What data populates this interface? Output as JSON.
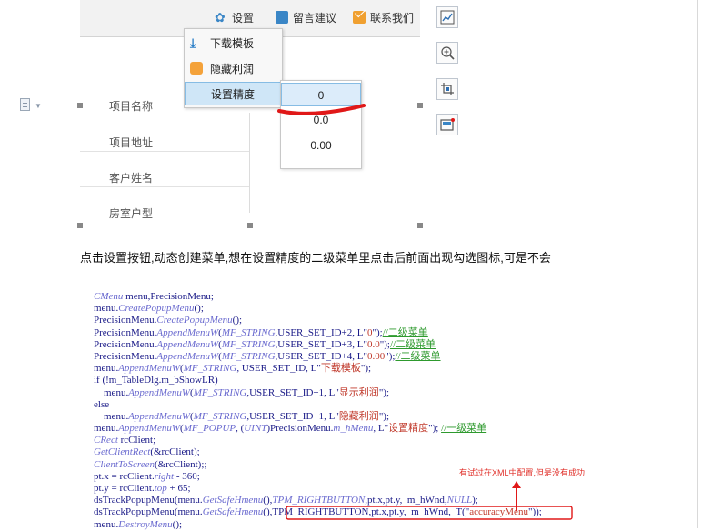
{
  "embedded_app": {
    "toolbar": [
      {
        "label": "设置",
        "icon": "gear-icon"
      },
      {
        "label": "留言建议",
        "icon": "message-icon"
      },
      {
        "label": "联系我们",
        "icon": "mail-icon"
      }
    ],
    "fields": [
      "项目名称",
      "项目地址",
      "客户姓名",
      "房室户型"
    ],
    "menu": [
      {
        "label": "下载模板",
        "icon": "download-icon"
      },
      {
        "label": "隐藏利润",
        "icon": "database-icon"
      },
      {
        "label": "设置精度",
        "icon": ""
      }
    ],
    "submenu": [
      "0",
      "0.0",
      "0.00"
    ]
  },
  "right_toolbar": [
    "chart-icon",
    "zoom-icon",
    "crop-icon",
    "frame-icon"
  ],
  "description": "点击设置按钮,动态创建菜单,想在设置精度的二级菜单里点击后前面出现勾选图标,可是不会",
  "code_lines": [
    [
      {
        "t": "t",
        "v": "CMenu"
      },
      {
        "t": "k",
        "v": " menu,PrecisionMenu;"
      }
    ],
    [
      {
        "t": "k",
        "v": "menu."
      },
      {
        "t": "t",
        "v": "CreatePopupMenu"
      },
      {
        "t": "k",
        "v": "();"
      }
    ],
    [
      {
        "t": "k",
        "v": "PrecisionMenu."
      },
      {
        "t": "t",
        "v": "CreatePopupMenu"
      },
      {
        "t": "k",
        "v": "();"
      }
    ],
    [
      {
        "t": "k",
        "v": "PrecisionMenu."
      },
      {
        "t": "t",
        "v": "AppendMenuW"
      },
      {
        "t": "k",
        "v": "("
      },
      {
        "t": "t",
        "v": "MF_STRING"
      },
      {
        "t": "k",
        "v": ",USER_SET_ID+2, L\""
      },
      {
        "t": "s",
        "v": "0"
      },
      {
        "t": "k",
        "v": "\");"
      },
      {
        "t": "c",
        "v": "//二级菜单"
      }
    ],
    [
      {
        "t": "k",
        "v": "PrecisionMenu."
      },
      {
        "t": "t",
        "v": "AppendMenuW"
      },
      {
        "t": "k",
        "v": "("
      },
      {
        "t": "t",
        "v": "MF_STRING"
      },
      {
        "t": "k",
        "v": ",USER_SET_ID+3, L\""
      },
      {
        "t": "s",
        "v": "0.0"
      },
      {
        "t": "k",
        "v": "\");"
      },
      {
        "t": "c",
        "v": "//二级菜单"
      }
    ],
    [
      {
        "t": "k",
        "v": "PrecisionMenu."
      },
      {
        "t": "t",
        "v": "AppendMenuW"
      },
      {
        "t": "k",
        "v": "("
      },
      {
        "t": "t",
        "v": "MF_STRING"
      },
      {
        "t": "k",
        "v": ",USER_SET_ID+4, L\""
      },
      {
        "t": "s",
        "v": "0.00"
      },
      {
        "t": "k",
        "v": "\");"
      },
      {
        "t": "c",
        "v": "//二级菜单"
      }
    ],
    [
      {
        "t": "k",
        "v": "menu."
      },
      {
        "t": "t",
        "v": "AppendMenuW"
      },
      {
        "t": "k",
        "v": "("
      },
      {
        "t": "t",
        "v": "MF_STRING"
      },
      {
        "t": "k",
        "v": ", USER_SET_ID, L\""
      },
      {
        "t": "s",
        "v": "下载模板"
      },
      {
        "t": "k",
        "v": "\");"
      }
    ],
    [
      {
        "t": "k",
        "v": "if (!m_TableDlg.m_bShowLR)"
      }
    ],
    [
      {
        "t": "k",
        "v": "    menu."
      },
      {
        "t": "t",
        "v": "AppendMenuW"
      },
      {
        "t": "k",
        "v": "("
      },
      {
        "t": "t",
        "v": "MF_STRING"
      },
      {
        "t": "k",
        "v": ",USER_SET_ID+1, L\""
      },
      {
        "t": "s",
        "v": "显示利润"
      },
      {
        "t": "k",
        "v": "\");"
      }
    ],
    [
      {
        "t": "k",
        "v": "else"
      }
    ],
    [
      {
        "t": "k",
        "v": "    menu."
      },
      {
        "t": "t",
        "v": "AppendMenuW"
      },
      {
        "t": "k",
        "v": "("
      },
      {
        "t": "t",
        "v": "MF_STRING"
      },
      {
        "t": "k",
        "v": ",USER_SET_ID+1, L\""
      },
      {
        "t": "s",
        "v": "隐藏利润"
      },
      {
        "t": "k",
        "v": "\");"
      }
    ],
    [
      {
        "t": "k",
        "v": "menu."
      },
      {
        "t": "t",
        "v": "AppendMenuW"
      },
      {
        "t": "k",
        "v": "("
      },
      {
        "t": "t",
        "v": "MF_POPUP"
      },
      {
        "t": "k",
        "v": ", ("
      },
      {
        "t": "t",
        "v": "UINT"
      },
      {
        "t": "k",
        "v": ")PrecisionMenu."
      },
      {
        "t": "t",
        "v": "m_hMenu"
      },
      {
        "t": "k",
        "v": ", L\""
      },
      {
        "t": "s",
        "v": "设置精度"
      },
      {
        "t": "k",
        "v": "\"); "
      },
      {
        "t": "c",
        "v": "//一级菜单"
      }
    ],
    [
      {
        "t": "t",
        "v": "CRect"
      },
      {
        "t": "k",
        "v": " rcClient;"
      }
    ],
    [
      {
        "t": "t",
        "v": "GetClientRect"
      },
      {
        "t": "k",
        "v": "(&rcClient);"
      }
    ],
    [
      {
        "t": "t",
        "v": "ClientToScreen"
      },
      {
        "t": "k",
        "v": "(&rcClient);;"
      }
    ],
    [
      {
        "t": "k",
        "v": "pt.x = rcClient."
      },
      {
        "t": "t",
        "v": "right"
      },
      {
        "t": "k",
        "v": " - 360;"
      }
    ],
    [
      {
        "t": "k",
        "v": "pt.y = rcClient."
      },
      {
        "t": "t",
        "v": "top"
      },
      {
        "t": "k",
        "v": " + 65;"
      }
    ],
    [
      {
        "t": "k",
        "v": "dsTrackPopupMenu(menu."
      },
      {
        "t": "t",
        "v": "GetSafeHmenu"
      },
      {
        "t": "k",
        "v": "(),"
      },
      {
        "t": "t",
        "v": "TPM_RIGHTBUTTON"
      },
      {
        "t": "k",
        "v": ",pt.x,pt.y,  m_hWnd,"
      },
      {
        "t": "t",
        "v": "NULL"
      },
      {
        "t": "k",
        "v": ");"
      }
    ],
    [
      {
        "t": "k",
        "v": "dsTrackPopupMenu(menu."
      },
      {
        "t": "t",
        "v": "GetSafeHmenu"
      },
      {
        "t": "k",
        "v": "(),"
      },
      {
        "t": "k",
        "v": "TPM_RIGHTBUTTON,pt.x,pt.y,  m_hWnd,_T(\""
      },
      {
        "t": "s",
        "v": "accuracyMenu"
      },
      {
        "t": "k",
        "v": "\"));"
      }
    ],
    [
      {
        "t": "k",
        "v": "menu."
      },
      {
        "t": "t",
        "v": "DestroyMenu"
      },
      {
        "t": "k",
        "v": "();"
      }
    ]
  ],
  "annotation_note": "有试过在XML中配置,但是没有成功",
  "colors": {
    "accent_blue": "#3a86c6",
    "annotation_red": "#e0302a",
    "code_blue": "#1b1b88"
  }
}
